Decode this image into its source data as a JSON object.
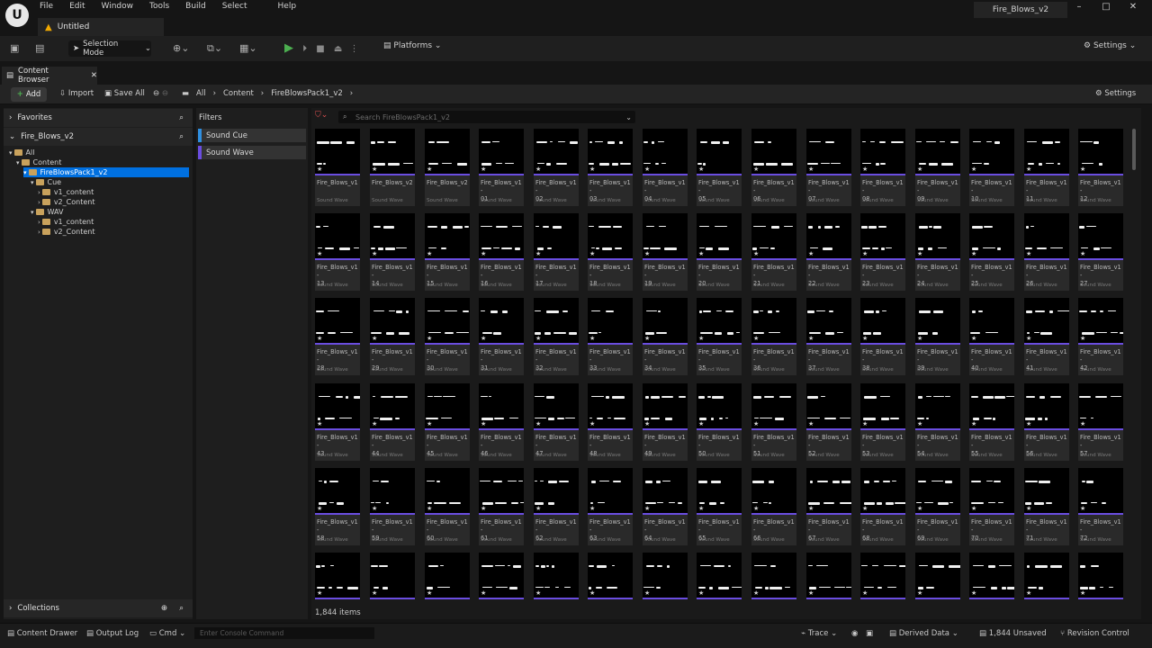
{
  "titlebar": {
    "menu": [
      "File",
      "Edit",
      "Window",
      "Tools",
      "Build",
      "Select",
      "Help"
    ],
    "doc_tab": "Untitled",
    "project_tab": "Fire_Blows_v2",
    "win_controls": [
      "–",
      "□",
      "✕"
    ]
  },
  "toolbar": {
    "selection_mode": "Selection Mode",
    "platforms": "Platforms",
    "settings": "Settings"
  },
  "content_browser": {
    "tab_title": "Content Browser",
    "add_label": "Add",
    "import_label": "Import",
    "save_all_label": "Save All",
    "breadcrumb": [
      "All",
      "Content",
      "FireBlowsPack1_v2"
    ],
    "settings_label": "Settings"
  },
  "left_panel": {
    "favorites": "Favorites",
    "project": "Fire_Blows_v2",
    "tree": [
      {
        "label": "All",
        "indent": 0
      },
      {
        "label": "Content",
        "indent": 1
      },
      {
        "label": "FireBlowsPack1_v2",
        "indent": 2,
        "selected": true
      },
      {
        "label": "Cue",
        "indent": 3
      },
      {
        "label": "v1_content",
        "indent": 4
      },
      {
        "label": "v2_Content",
        "indent": 4
      },
      {
        "label": "WAV",
        "indent": 3
      },
      {
        "label": "v1_content",
        "indent": 4
      },
      {
        "label": "v2_Content",
        "indent": 4
      }
    ],
    "collections": "Collections"
  },
  "filters": {
    "title": "Filters",
    "items": [
      {
        "label": "Sound Cue",
        "color": "#2f8fe0"
      },
      {
        "label": "Sound Wave",
        "color": "#6a4de0"
      }
    ]
  },
  "search": {
    "placeholder": "Search FireBlowsPack1_v2"
  },
  "assets": {
    "type_label": "Sound Wave",
    "row1": [
      {
        "l1": "Fire_Blows_v1",
        "l2": ""
      },
      {
        "l1": "Fire_Blows_v2",
        "l2": ""
      },
      {
        "l1": "Fire_Blows_v2",
        "l2": ""
      },
      {
        "l1": "Fire_Blows_v1-",
        "l2": "01"
      },
      {
        "l1": "Fire_Blows_v1-",
        "l2": "02"
      },
      {
        "l1": "Fire_Blows_v1-",
        "l2": "03"
      },
      {
        "l1": "Fire_Blows_v1-",
        "l2": "04"
      },
      {
        "l1": "Fire_Blows_v1-",
        "l2": "05"
      },
      {
        "l1": "Fire_Blows_v1-",
        "l2": "06"
      },
      {
        "l1": "Fire_Blows_v1-",
        "l2": "07"
      },
      {
        "l1": "Fire_Blows_v1-",
        "l2": "08"
      },
      {
        "l1": "Fire_Blows_v1-",
        "l2": "09"
      },
      {
        "l1": "Fire_Blows_v1-",
        "l2": "10"
      },
      {
        "l1": "Fire_Blows_v1-",
        "l2": "11"
      },
      {
        "l1": "Fire_Blows_v1-",
        "l2": "12"
      }
    ],
    "numbered_rows": [
      [
        "13",
        "14",
        "15",
        "16",
        "17",
        "18",
        "19",
        "20",
        "21",
        "22",
        "23",
        "24",
        "25",
        "26",
        "27"
      ],
      [
        "28",
        "29",
        "30",
        "31",
        "32",
        "33",
        "34",
        "35",
        "36",
        "37",
        "38",
        "39",
        "40",
        "41",
        "42"
      ],
      [
        "43",
        "44",
        "45",
        "46",
        "47",
        "48",
        "49",
        "50",
        "51",
        "52",
        "53",
        "54",
        "55",
        "56",
        "57"
      ],
      [
        "58",
        "59",
        "60",
        "61",
        "62",
        "63",
        "64",
        "65",
        "66",
        "67",
        "68",
        "69",
        "70",
        "71",
        "72"
      ]
    ],
    "numbered_prefix": "Fire_Blows_v1-",
    "item_count": "1,844 items"
  },
  "statusbar": {
    "content_drawer": "Content Drawer",
    "output_log": "Output Log",
    "cmd": "Cmd",
    "console_placeholder": "Enter Console Command",
    "trace": "Trace",
    "derived_data": "Derived Data",
    "unsaved": "1,844 Unsaved",
    "revision_control": "Revision Control"
  }
}
